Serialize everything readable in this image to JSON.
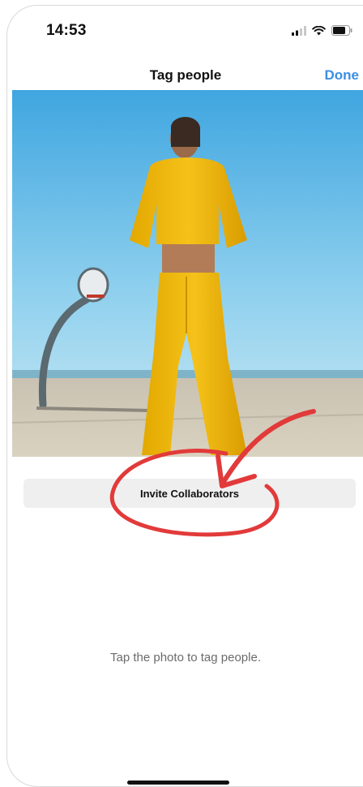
{
  "status_bar": {
    "time": "14:53",
    "icons": [
      "signal-icon",
      "wifi-icon",
      "battery-icon"
    ]
  },
  "header": {
    "title": "Tag people",
    "done_label": "Done",
    "done_color": "#3a8ee6"
  },
  "photo": {
    "icon": "photo-image"
  },
  "invite": {
    "label": "Invite Collaborators"
  },
  "annotation": {
    "color": "#e23a3a"
  },
  "hint": {
    "text": "Tap the photo to tag people."
  }
}
